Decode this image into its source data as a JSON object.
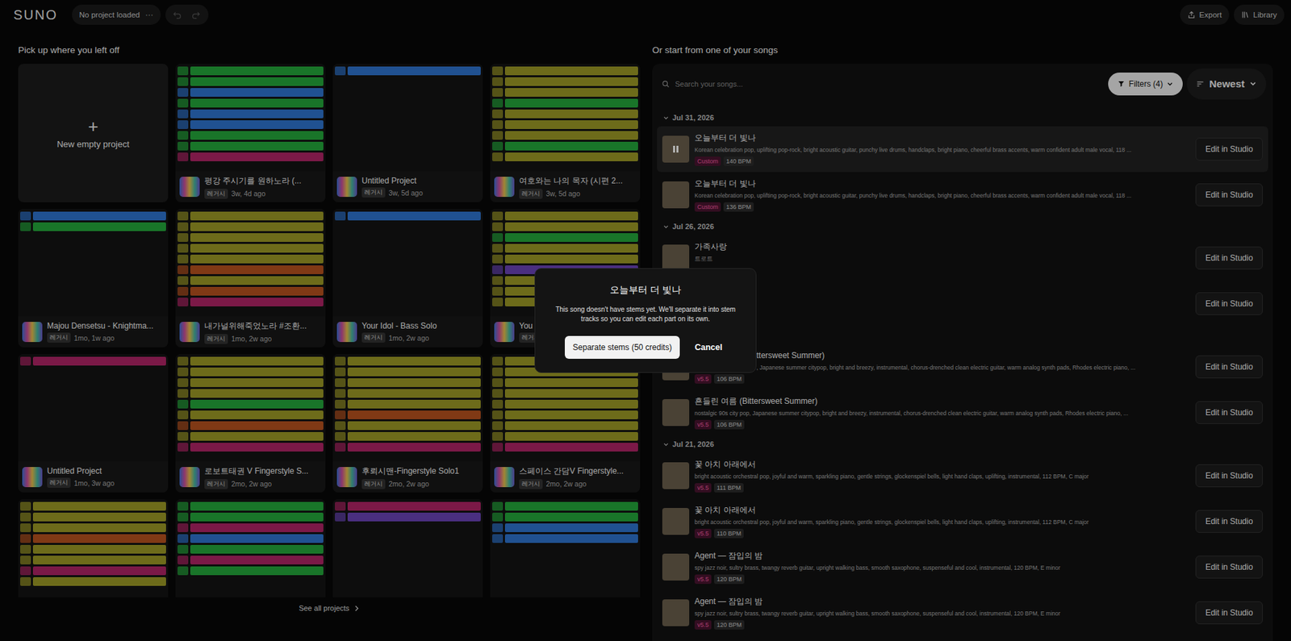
{
  "topbar": {
    "logo": "SUNO",
    "project_status": "No project loaded",
    "project_menu": "···",
    "history": [
      {
        "kind": "undo",
        "disabled": true
      },
      {
        "kind": "redo",
        "disabled": true
      }
    ],
    "actions": [
      {
        "kind": "export",
        "label": "Export"
      },
      {
        "kind": "library",
        "label": "Library"
      }
    ]
  },
  "left": {
    "title": "Pick up where you left off",
    "new_project": {
      "icon": "+",
      "label": "New empty project"
    },
    "see_all": "See all projects",
    "projects": [
      {
        "title": "평강 주시기를 원하노라 (...",
        "badge": "레거시",
        "time": "3w, 4d ago",
        "tracks": [
          "#24a83c",
          "#24a83c",
          "#2f74d0",
          "#24a83c",
          "#2f74d0",
          "#2f74d0",
          "#24a83c",
          "#24a83c",
          "#b02466"
        ]
      },
      {
        "title": "Untitled Project",
        "badge": "레거시",
        "time": "3w, 5d ago",
        "tracks": [
          "#2f74d0"
        ]
      },
      {
        "title": "여호와는 나의 목자 (시편 2...",
        "badge": "레거시",
        "time": "3w, 5d ago",
        "tracks": [
          "#9c9a26",
          "#9c9a26",
          "#9c9a26",
          "#24a83c",
          "#9c9a26",
          "#9c9a26",
          "#9c9a26",
          "#24a83c",
          "#9c9a26"
        ]
      },
      {
        "title": "Majou Densetsu - Knightma...",
        "badge": "레거시",
        "time": "1mo, 1w ago",
        "tracks": [
          "#2f74d0",
          "#24a83c"
        ]
      },
      {
        "title": "내가널위해죽었노라 #조환...",
        "badge": "레거시",
        "time": "1mo, 2w ago",
        "tracks": [
          "#9c9a26",
          "#9c9a26",
          "#9c9a26",
          "#9c9a26",
          "#9c9a26",
          "#b8521f",
          "#9c9a26",
          "#b8521f",
          "#b02466"
        ]
      },
      {
        "title": "Your Idol - Bass Solo",
        "badge": "레거시",
        "time": "1mo, 2w ago",
        "tracks": [
          "#2f74d0"
        ]
      },
      {
        "title": "You",
        "badge": "레거시",
        "time": "",
        "tracks": [
          "#9c9a26",
          "#9c9a26",
          "#24a83c",
          "#9c9a26",
          "#9c9a26",
          "#6a44b8",
          "#9c9a26",
          "#9c9a26",
          "#9c9a26"
        ]
      },
      {
        "title": "Untitled Project",
        "badge": "레거시",
        "time": "1mo, 3w ago",
        "tracks": [
          "#b02466"
        ]
      },
      {
        "title": "로보트태권 V Fingerstyle S...",
        "badge": "레거시",
        "time": "2mo, 2w ago",
        "tracks": [
          "#9c9a26",
          "#9c9a26",
          "#9c9a26",
          "#9c9a26",
          "#24a83c",
          "#9c9a26",
          "#b8521f",
          "#9c9a26",
          "#b02466"
        ]
      },
      {
        "title": "후뢰시맨-Fingerstyle Solo1",
        "badge": "레거시",
        "time": "2mo, 2w ago",
        "tracks": [
          "#9c9a26",
          "#9c9a26",
          "#9c9a26",
          "#9c9a26",
          "#9c9a26",
          "#b8521f",
          "#9c9a26",
          "#9c9a26",
          "#b02466"
        ]
      },
      {
        "title": "스페이스 간담V Fingerstyle...",
        "badge": "레거시",
        "time": "2mo, 2w ago",
        "tracks": [
          "#9c9a26",
          "#9c9a26",
          "#9c9a26",
          "#9c9a26",
          "#9c9a26",
          "#9c9a26",
          "#9c9a26",
          "#9c9a26",
          "#b02466"
        ]
      },
      {
        "title": "",
        "badge": "",
        "time": "",
        "tracks": [
          "#9c9a26",
          "#9c9a26",
          "#9c9a26",
          "#b8521f",
          "#9c9a26",
          "#9c9a26",
          "#b02466",
          "#9c9a26"
        ]
      },
      {
        "title": "",
        "badge": "",
        "time": "",
        "tracks": [
          "#24a83c",
          "#24a83c",
          "#b02466",
          "#2f74d0",
          "#24a83c",
          "#b02466",
          "#24a83c"
        ]
      },
      {
        "title": "",
        "badge": "",
        "time": "",
        "tracks": [
          "#b02466",
          "#6a44b8"
        ]
      },
      {
        "title": "",
        "badge": "",
        "time": "",
        "tracks": [
          "#24a83c",
          "#24a83c",
          "#2f74d0",
          "#2f74d0"
        ]
      }
    ]
  },
  "right": {
    "title": "Or start from one of your songs",
    "search_placeholder": "Search your songs...",
    "filters": "Filters (4)",
    "sort": "Newest",
    "groups": [
      {
        "date": "Jul 31, 2026",
        "songs": [
          {
            "kind": "full",
            "title": "오늘부터 더 빛나",
            "description": "Korean celebration pop, uplifting pop-rock, bright acoustic guitar, punchy live drums, handclaps, bright piano, cheerful brass accents, warm confident adult male vocal, 118 ...",
            "tags": [
              {
                "label": "Custom",
                "kind": "version"
              },
              {
                "label": "140 BPM",
                "kind": "bpm"
              }
            ],
            "action": "Edit in Studio",
            "selected": true,
            "playing": true
          },
          {
            "kind": "full",
            "title": "오늘부터 더 빛나",
            "description": "Korean celebration pop, uplifting pop-rock, bright acoustic guitar, punchy live drums, handclaps, bright piano, cheerful brass accents, warm confident adult male vocal, 118 ...",
            "tags": [
              {
                "label": "Custom",
                "kind": "version"
              },
              {
                "label": "136 BPM",
                "kind": "bpm"
              }
            ],
            "action": "Edit in Studio",
            "selected": false,
            "playing": false
          }
        ]
      },
      {
        "date": "Jul 26, 2026",
        "songs": [
          {
            "kind": "full",
            "title": "가족사랑",
            "description": "트로트",
            "tags": [],
            "action": "Edit in Studio",
            "selected": false,
            "playing": false
          },
          {
            "kind": "covered",
            "title": "",
            "description": "",
            "tags": [],
            "action": "Edit in Studio",
            "selected": false,
            "playing": false
          }
        ]
      },
      {
        "date": "",
        "songs": [
          {
            "kind": "partial",
            "title": "ttersweet Summer)",
            "description": ", Japanese summer citypop, bright and breezy, instrumental, chorus-drenched clean electric guitar, warm analog synth pads, Rhodes electric piano, ...",
            "tags": [
              {
                "label": "v5.5",
                "kind": "version"
              },
              {
                "label": "106 BPM",
                "kind": "bpm"
              }
            ],
            "action": "Edit in Studio",
            "selected": false,
            "playing": false
          },
          {
            "kind": "full",
            "title": "흔들린 여름 (Bittersweet Summer)",
            "description": "nostalgic 90s city pop, Japanese summer citypop, bright and breezy, instrumental, chorus-drenched clean electric guitar, warm analog synth pads, Rhodes electric piano, ...",
            "tags": [
              {
                "label": "v5.5",
                "kind": "version"
              },
              {
                "label": "106 BPM",
                "kind": "bpm"
              }
            ],
            "action": "Edit in Studio",
            "selected": false,
            "playing": false
          }
        ]
      },
      {
        "date": "Jul 21, 2026",
        "songs": [
          {
            "kind": "full",
            "title": "꽃 아치 아래에서",
            "description": "bright acoustic orchestral pop, joyful and warm, sparkling piano, gentle strings, glockenspiel bells, light hand claps, uplifting, instrumental, 112 BPM, C major",
            "tags": [
              {
                "label": "v5.5",
                "kind": "version"
              },
              {
                "label": "111 BPM",
                "kind": "bpm"
              }
            ],
            "action": "Edit in Studio",
            "selected": false,
            "playing": false
          },
          {
            "kind": "full",
            "title": "꽃 아치 아래에서",
            "description": "bright acoustic orchestral pop, joyful and warm, sparkling piano, gentle strings, glockenspiel bells, light hand claps, uplifting, instrumental, 112 BPM, C major",
            "tags": [
              {
                "label": "v5.5",
                "kind": "version"
              },
              {
                "label": "110 BPM",
                "kind": "bpm"
              }
            ],
            "action": "Edit in Studio",
            "selected": false,
            "playing": false
          },
          {
            "kind": "full",
            "title": "Agent — 잠입의 밤",
            "description": "spy jazz noir, sultry brass, twangy reverb guitar, upright walking bass, smooth saxophone, suspenseful and cool, instrumental, 120 BPM, E minor",
            "tags": [
              {
                "label": "v5.5",
                "kind": "version"
              },
              {
                "label": "120 BPM",
                "kind": "bpm"
              }
            ],
            "action": "Edit in Studio",
            "selected": false,
            "playing": false
          },
          {
            "kind": "full",
            "title": "Agent — 잠입의 밤",
            "description": "spy jazz noir, sultry brass, twangy reverb guitar, upright walking bass, smooth saxophone, suspenseful and cool, instrumental, 120 BPM, E minor",
            "tags": [
              {
                "label": "v5.5",
                "kind": "version"
              },
              {
                "label": "120 BPM",
                "kind": "bpm"
              }
            ],
            "action": "Edit in Studio",
            "selected": false,
            "playing": false
          }
        ]
      }
    ]
  },
  "dialog": {
    "title": "오늘부터 더 빛나",
    "message": "This song doesn't have stems yet. We'll separate it into stem tracks so you can edit each part on its own.",
    "confirm": "Separate stems (50 credits)",
    "cancel": "Cancel"
  }
}
